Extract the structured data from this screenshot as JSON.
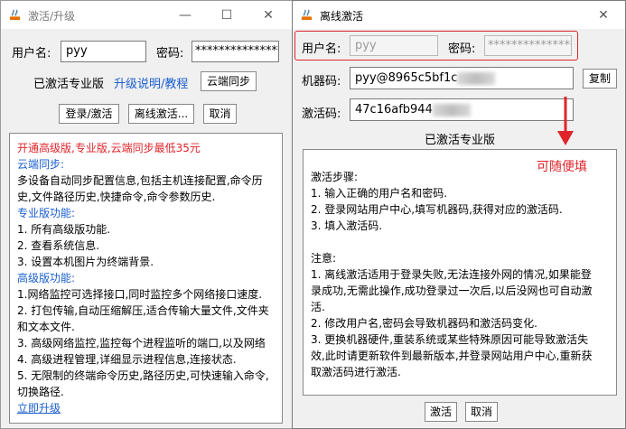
{
  "colors": {
    "accent_red": "#e0242a",
    "link_blue": "#1a5fd0",
    "promo_red": "#e0242a"
  },
  "win1": {
    "title": "激活/升级",
    "username_label": "用户名:",
    "username_value": "pyy",
    "password_label": "密码:",
    "password_value": "***************",
    "status": "已激活专业版",
    "upgrade_link": "升级说明/教程",
    "cloud_sync_btn": "云端同步",
    "login_btn": "登录/激活",
    "offline_btn": "离线激活...",
    "cancel_btn": "取消",
    "info": {
      "promo": "开通高级版,专业版,云端同步最低35元",
      "cloud_heading": "云端同步:",
      "cloud_l1": "多设备自动同步配置信息,包括主机连接配置,命令历",
      "cloud_l2": "史,文件路径历史,快捷命令,命令参数历史.",
      "pro_heading": "专业版功能:",
      "pro_1": "1. 所有高级版功能.",
      "pro_2": "2. 查看系统信息.",
      "pro_3": "3. 设置本机图片为终端背景.",
      "adv_heading": "高级版功能:",
      "adv_1": "1.网络监控可选择接口,同时监控多个网络接口速度.",
      "adv_2a": "2. 打包传输,自动压缩解压,适合传输大量文件,文件夹",
      "adv_2b": "和文本文件.",
      "adv_3": "3. 高级网络监控,监控每个进程监听的端口,以及网络",
      "adv_4": "4. 高级进程管理,详细显示进程信息,连接状态.",
      "adv_5a": "5. 无限制的终端命令历史,路径历史,可快速输入命令,",
      "adv_5b": "切换路径.",
      "upgrade_now": "立即升级"
    }
  },
  "win2": {
    "title": "离线激活",
    "username_label": "用户名:",
    "username_value": "pyy",
    "password_label": "密码:",
    "password_value": "***************",
    "machine_label": "机器码:",
    "machine_value": "pyy@8965c5bf1c",
    "copy_btn": "复制",
    "activation_label": "激活码:",
    "activation_value": "47c16afb944",
    "status": "已激活专业版",
    "annotation": "可随便填",
    "steps": {
      "heading": "激活步骤:",
      "s1": "1. 输入正确的用户名和密码.",
      "s2": "2. 登录网站用户中心,填写机器码,获得对应的激活码.",
      "s3": "3. 填入激活码.",
      "note_heading": "注意:",
      "n1a": "1. 离线激活适用于登录失败,无法连接外网的情况,如果能登",
      "n1b": "录成功,无需此操作,成功登录过一次后,以后没网也可自动激",
      "n1c": "活.",
      "n2": "2. 修改用户名,密码会导致机器码和激活码变化.",
      "n3a": "3. 更换机器硬件,重装系统或某些特殊原因可能导致激活失",
      "n3b": "效,此时请更新软件到最新版本,并登录网站用户中心,重新获",
      "n3c": "取激活码进行激活."
    },
    "activate_btn": "激活",
    "cancel_btn": "取消"
  }
}
